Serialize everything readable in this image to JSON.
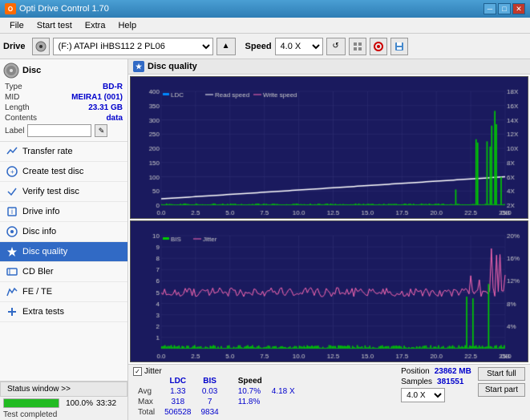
{
  "titleBar": {
    "title": "Opti Drive Control 1.70",
    "minimize": "─",
    "maximize": "□",
    "close": "✕"
  },
  "menuBar": {
    "items": [
      "File",
      "Start test",
      "Extra",
      "Help"
    ]
  },
  "toolbar": {
    "driveLabel": "Drive",
    "driveValue": "(F:)  ATAPI iHBS112  2 PL06",
    "speedLabel": "Speed",
    "speedValue": "4.0 X"
  },
  "disc": {
    "sectionTitle": "Disc",
    "typeLabel": "Type",
    "typeValue": "BD-R",
    "midLabel": "MID",
    "midValue": "MEIRA1 (001)",
    "lengthLabel": "Length",
    "lengthValue": "23.31 GB",
    "contentsLabel": "Contents",
    "contentsValue": "data",
    "labelLabel": "Label",
    "labelValue": ""
  },
  "navItems": [
    {
      "id": "transfer-rate",
      "label": "Transfer rate",
      "icon": "📊"
    },
    {
      "id": "create-test-disc",
      "label": "Create test disc",
      "icon": "💿"
    },
    {
      "id": "verify-test-disc",
      "label": "Verify test disc",
      "icon": "✔"
    },
    {
      "id": "drive-info",
      "label": "Drive info",
      "icon": "ℹ"
    },
    {
      "id": "disc-info",
      "label": "Disc info",
      "icon": "📀"
    },
    {
      "id": "disc-quality",
      "label": "Disc quality",
      "icon": "★",
      "active": true
    },
    {
      "id": "cd-bler",
      "label": "CD Bler",
      "icon": "📋"
    },
    {
      "id": "fe-te",
      "label": "FE / TE",
      "icon": "📈"
    },
    {
      "id": "extra-tests",
      "label": "Extra tests",
      "icon": "🔧"
    }
  ],
  "statusWindow": {
    "label": "Status window >>"
  },
  "progressBar": {
    "percent": 100,
    "percentText": "100.0%",
    "time": "33:32"
  },
  "chartHeader": {
    "title": "Disc quality",
    "icon": "★"
  },
  "chart1": {
    "legend": [
      "LDC",
      "Read speed",
      "Write speed"
    ],
    "yMax": 400,
    "yMin": 0,
    "yLabelsLeft": [
      "400",
      "350",
      "300",
      "250",
      "200",
      "150",
      "100",
      "50"
    ],
    "yLabelsRight": [
      "18X",
      "16X",
      "14X",
      "12X",
      "10X",
      "8X",
      "6X",
      "4X",
      "2X"
    ],
    "xLabels": [
      "0.0",
      "2.5",
      "5.0",
      "7.5",
      "10.0",
      "12.5",
      "15.0",
      "17.5",
      "20.0",
      "22.5",
      "25.0 GB"
    ]
  },
  "chart2": {
    "legend": [
      "BIS",
      "Jitter"
    ],
    "yMax": 10,
    "yMin": 0,
    "yLabelsLeft": [
      "10",
      "9",
      "8",
      "7",
      "6",
      "5",
      "4",
      "3",
      "2",
      "1"
    ],
    "yLabelsRight": [
      "20%",
      "16%",
      "12%",
      "8%",
      "4%"
    ],
    "xLabels": [
      "0.0",
      "2.5",
      "5.0",
      "7.5",
      "10.0",
      "12.5",
      "15.0",
      "17.5",
      "20.0",
      "22.5",
      "25.0 GB"
    ]
  },
  "stats": {
    "columns": [
      "",
      "LDC",
      "BIS",
      "",
      "Jitter",
      "Speed"
    ],
    "rows": [
      {
        "label": "Avg",
        "ldc": "1.33",
        "bis": "0.03",
        "jitter": "10.7%",
        "speed": "4.18 X"
      },
      {
        "label": "Max",
        "ldc": "318",
        "bis": "7",
        "jitter": "11.8%",
        "speed": ""
      },
      {
        "label": "Total",
        "ldc": "506528",
        "bis": "9834",
        "jitter": "",
        "speed": ""
      }
    ],
    "positionLabel": "Position",
    "positionValue": "23862 MB",
    "samplesLabel": "Samples",
    "samplesValue": "381551",
    "jitterChecked": true,
    "jitterLabel": "Jitter",
    "speedDropdownValue": "4.0 X"
  },
  "actionBtns": {
    "startFull": "Start full",
    "startPart": "Start part"
  },
  "statusText": "Test completed",
  "colors": {
    "accent": "#316ac5",
    "ldc": "#00ff00",
    "readSpeed": "#ffffff",
    "writeSpeed": "#ff69b4",
    "bis": "#00ff00",
    "jitter": "#ff69b4",
    "chartBg": "#1a1a5e",
    "gridLine": "#444488"
  }
}
